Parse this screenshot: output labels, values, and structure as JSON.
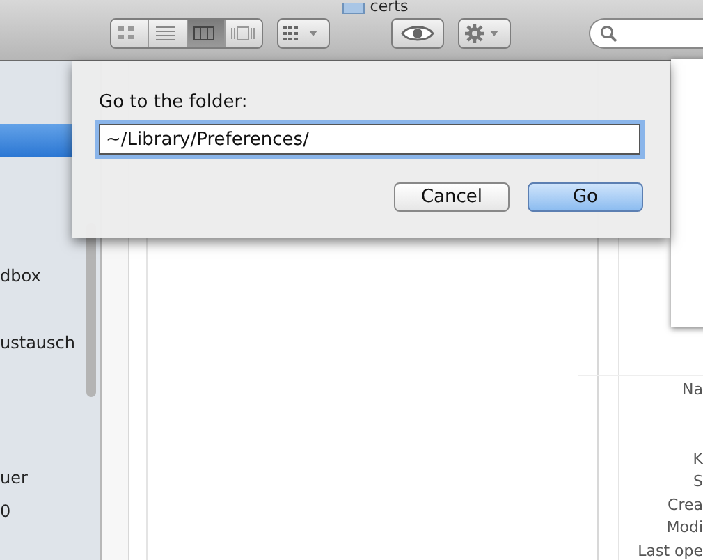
{
  "window": {
    "title": "certs"
  },
  "toolbar": {
    "view_buttons": [
      {
        "kind": "icons",
        "selected": false
      },
      {
        "kind": "list",
        "selected": false
      },
      {
        "kind": "columns",
        "selected": true
      },
      {
        "kind": "coverflow",
        "selected": false
      }
    ]
  },
  "sidebar": {
    "items": [
      {
        "selected": true
      },
      {
        "label": "dbox",
        "selected": false
      },
      {
        "label": "ustausch",
        "selected": false
      },
      {
        "label": "uer",
        "selected": false
      },
      {
        "label": "0",
        "selected": false
      }
    ]
  },
  "preview": {
    "labels": [
      "Na",
      "K",
      "S",
      "Crea",
      "Modi",
      "Last ope"
    ]
  },
  "dialog": {
    "prompt": "Go to the folder:",
    "path": "~/Library/Preferences/",
    "buttons": [
      {
        "label": "Cancel",
        "default": false
      },
      {
        "label": "Go",
        "default": true
      }
    ]
  }
}
